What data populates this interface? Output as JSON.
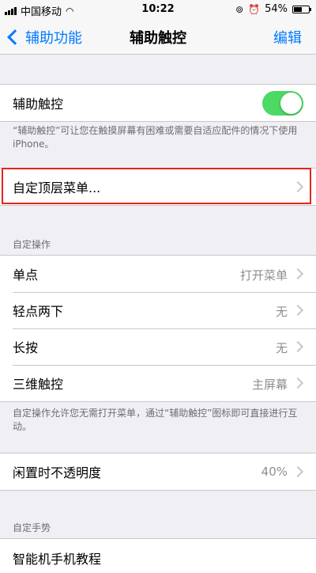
{
  "status_bar": {
    "carrier": "中国移动",
    "time": "10:22",
    "battery_percent": "54%",
    "battery_level": 0.54
  },
  "nav": {
    "back_label": "辅助功能",
    "title": "辅助触控",
    "edit_label": "编辑"
  },
  "assistive_touch": {
    "label": "辅助触控",
    "enabled": true,
    "footnote": "“辅助触控”可让您在触摸屏幕有困难或需要自适应配件的情况下使用 iPhone。"
  },
  "customize_menu": {
    "label": "自定顶层菜单..."
  },
  "custom_actions": {
    "header": "自定操作",
    "items": [
      {
        "label": "单点",
        "value": "打开菜单"
      },
      {
        "label": "轻点两下",
        "value": "无"
      },
      {
        "label": "长按",
        "value": "无"
      },
      {
        "label": "三维触控",
        "value": "主屏幕"
      }
    ],
    "footnote": "自定操作允许您无需打开菜单，通过“辅助触控”图标即可直接进行互动。"
  },
  "idle_opacity": {
    "label": "闲置时不透明度",
    "value": "40%"
  },
  "custom_gestures": {
    "header": "自定手势",
    "partial_item": "智能机手机教程"
  },
  "colors": {
    "accent": "#007aff",
    "toggle_on": "#4cd964",
    "highlight": "#e0261a"
  }
}
